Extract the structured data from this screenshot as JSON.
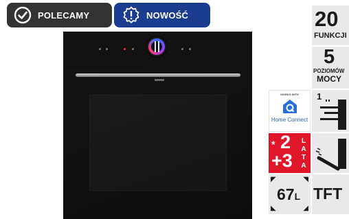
{
  "badges": [
    {
      "label": "POLECAMY",
      "icon": "check-circle-icon",
      "color": "#333333"
    },
    {
      "label": "NOWOŚĆ",
      "icon": "exclamation-badge-icon",
      "color": "#1a3d8f"
    }
  ],
  "product": {
    "icon": "oven-image"
  },
  "features": {
    "functions": {
      "value": "20",
      "label": "FUNKCJI"
    },
    "power_levels": {
      "value": "5",
      "label_top": "POZIOMÓW",
      "label_bottom": "MOCY"
    },
    "home_connect": {
      "caption": "WORKS WITH",
      "brand": "Home Connect",
      "icon": "home-connect-icon"
    },
    "rack_levels": {
      "value": "1",
      "icon": "telescopic-rails-icon"
    },
    "warranty": {
      "prefix": "*",
      "years_a": "2",
      "years_b": "+3",
      "word": [
        "L",
        "A",
        "T",
        "A"
      ],
      "color": "#e0162b"
    },
    "door": {
      "icon": "soft-close-door-icon"
    },
    "capacity": {
      "value": "67",
      "unit": "L"
    },
    "display": {
      "label": "TFT"
    }
  }
}
